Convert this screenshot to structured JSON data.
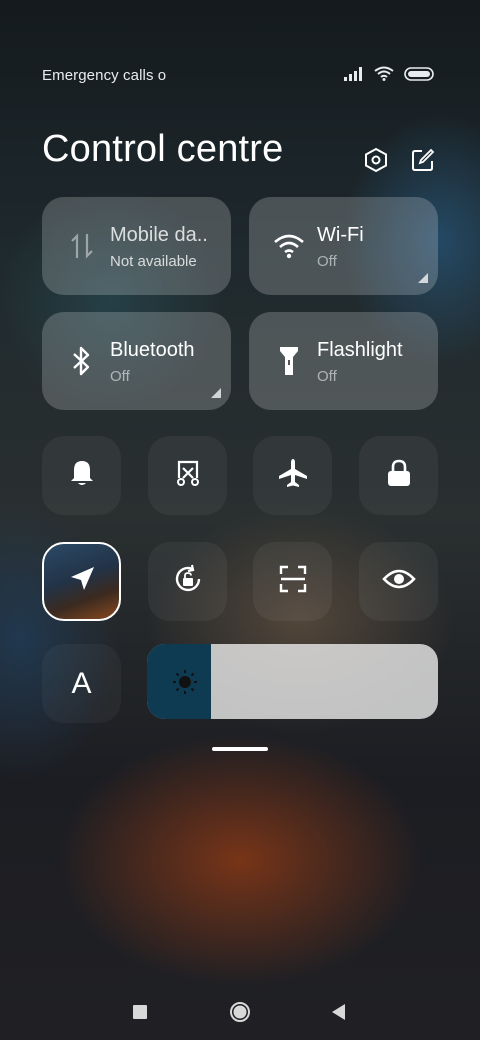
{
  "status_bar": {
    "carrier_text": "Emergency calls o",
    "icons": [
      "signal-icon",
      "wifi-icon",
      "battery-icon"
    ]
  },
  "header": {
    "title": "Control centre",
    "icons": [
      "settings-icon",
      "edit-icon"
    ]
  },
  "tiles": [
    {
      "label": "Mobile da..",
      "status": "Not available",
      "icon": "mobile-data-icon"
    },
    {
      "label": "Wi-Fi",
      "status": "Off",
      "icon": "wifi-icon"
    },
    {
      "label": "Bluetooth",
      "status": "Off",
      "icon": "bluetooth-icon"
    },
    {
      "label": "Flashlight",
      "status": "Off",
      "icon": "flashlight-icon"
    }
  ],
  "toggles_row1": [
    "bell-icon",
    "screenshot-icon",
    "airplane-icon",
    "lock-icon"
  ],
  "toggles_row2": [
    "location-icon",
    "rotation-lock-icon",
    "scanner-icon",
    "eye-icon"
  ],
  "font_toggle": {
    "label": "A"
  },
  "brightness": {
    "level_fraction": 0.22,
    "icon": "brightness-icon"
  },
  "navigation": [
    "recents-icon",
    "home-icon",
    "back-icon"
  ]
}
